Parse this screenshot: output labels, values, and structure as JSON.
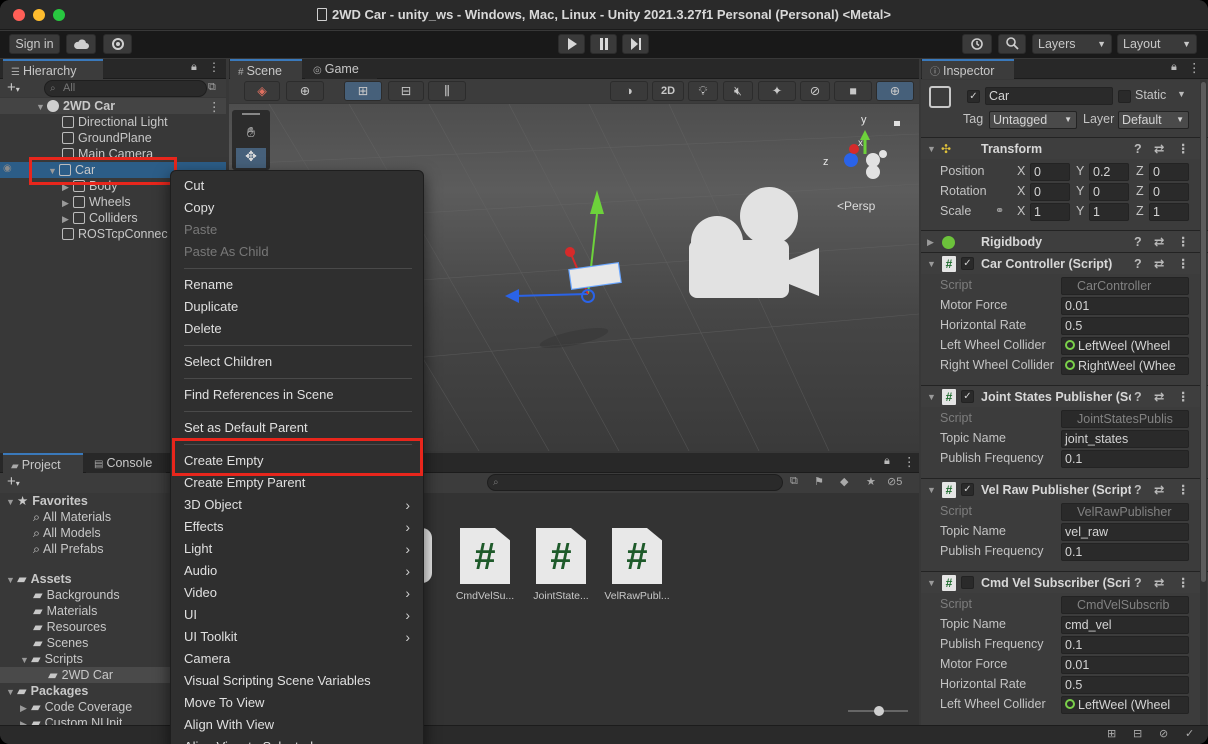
{
  "window": {
    "title": "2WD Car - unity_ws - Windows, Mac, Linux - Unity 2021.3.27f1 Personal (Personal) <Metal>"
  },
  "toolbar": {
    "sign_in": "Sign in",
    "layers": "Layers",
    "layout": "Layout"
  },
  "hierarchy": {
    "tab": "Hierarchy",
    "search_placeholder": "All",
    "scene": "2WD Car",
    "items": [
      "Directional Light",
      "GroundPlane",
      "Main Camera",
      "Car",
      "Body",
      "Wheels",
      "Colliders",
      "ROSTcpConnec"
    ]
  },
  "scene_view": {
    "tab_scene": "Scene",
    "tab_game": "Game",
    "mode_2d": "2D",
    "persp": "<Persp",
    "gizmo": {
      "x": "x",
      "y": "y",
      "z": "z"
    }
  },
  "context_menu": {
    "items": [
      {
        "label": "Cut",
        "disabled": false
      },
      {
        "label": "Copy",
        "disabled": false
      },
      {
        "label": "Paste",
        "disabled": true
      },
      {
        "label": "Paste As Child",
        "disabled": true
      },
      {
        "label": "Rename",
        "disabled": false
      },
      {
        "label": "Duplicate",
        "disabled": false
      },
      {
        "label": "Delete",
        "disabled": false
      },
      {
        "label": "Select Children",
        "disabled": false
      },
      {
        "label": "Find References in Scene",
        "disabled": false
      },
      {
        "label": "Set as Default Parent",
        "disabled": false
      },
      {
        "label": "Create Empty",
        "disabled": false,
        "highlighted": true
      },
      {
        "label": "Create Empty Parent",
        "disabled": false
      },
      {
        "label": "3D Object",
        "submenu": true
      },
      {
        "label": "Effects",
        "submenu": true
      },
      {
        "label": "Light",
        "submenu": true
      },
      {
        "label": "Audio",
        "submenu": true
      },
      {
        "label": "Video",
        "submenu": true
      },
      {
        "label": "UI",
        "submenu": true
      },
      {
        "label": "UI Toolkit",
        "submenu": true
      },
      {
        "label": "Camera",
        "disabled": false
      },
      {
        "label": "Visual Scripting Scene Variables",
        "disabled": false
      },
      {
        "label": "Move To View",
        "disabled": false
      },
      {
        "label": "Align With View",
        "disabled": false
      },
      {
        "label": "Align View to Selected",
        "disabled": false
      }
    ]
  },
  "project": {
    "tab_project": "Project",
    "tab_console": "Console",
    "favorites": "Favorites",
    "favorites_items": [
      "All Materials",
      "All Models",
      "All Prefabs"
    ],
    "assets": "Assets",
    "assets_items": [
      "Backgrounds",
      "Materials",
      "Resources",
      "Scenes",
      "Scripts"
    ],
    "scripts_child": "2WD Car",
    "packages": "Packages",
    "packages_items": [
      "Code Coverage",
      "Custom NUnit"
    ],
    "hidden_count": "5",
    "files": [
      "CmdVelSu...",
      "JointState...",
      "VelRawPubl..."
    ]
  },
  "inspector": {
    "tab": "Inspector",
    "object_name": "Car",
    "static_label": "Static",
    "tag_label": "Tag",
    "tag_value": "Untagged",
    "layer_label": "Layer",
    "layer_value": "Default",
    "transform": {
      "title": "Transform",
      "position_label": "Position",
      "position": [
        "0",
        "0.2",
        "0"
      ],
      "rotation_label": "Rotation",
      "rotation": [
        "0",
        "0",
        "0"
      ],
      "scale_label": "Scale",
      "scale": [
        "1",
        "1",
        "1"
      ],
      "axes": [
        "X",
        "Y",
        "Z"
      ]
    },
    "rigidbody": {
      "title": "Rigidbody"
    },
    "car_controller": {
      "title": "Car Controller (Script)",
      "rows": [
        {
          "label": "Script",
          "value": "CarController",
          "dim": true
        },
        {
          "label": "Motor Force",
          "value": "0.01"
        },
        {
          "label": "Horizontal Rate",
          "value": "0.5"
        },
        {
          "label": "Left Wheel Collider",
          "value": "LeftWeel (Wheel"
        },
        {
          "label": "Right Wheel Collider",
          "value": "RightWeel (Whee"
        }
      ]
    },
    "joint_states": {
      "title": "Joint States Publisher (Sc",
      "rows": [
        {
          "label": "Script",
          "value": "JointStatesPublis",
          "dim": true
        },
        {
          "label": "Topic Name",
          "value": "joint_states"
        },
        {
          "label": "Publish Frequency",
          "value": "0.1"
        }
      ]
    },
    "vel_raw": {
      "title": "Vel Raw Publisher (Script",
      "rows": [
        {
          "label": "Script",
          "value": "VelRawPublisher",
          "dim": true
        },
        {
          "label": "Topic Name",
          "value": "vel_raw"
        },
        {
          "label": "Publish Frequency",
          "value": "0.1"
        }
      ]
    },
    "cmd_vel": {
      "title": "Cmd Vel Subscriber (Scri",
      "rows": [
        {
          "label": "Script",
          "value": "CmdVelSubscrib",
          "dim": true
        },
        {
          "label": "Topic Name",
          "value": "cmd_vel"
        },
        {
          "label": "Publish Frequency",
          "value": "0.1"
        },
        {
          "label": "Motor Force",
          "value": "0.01"
        },
        {
          "label": "Horizontal Rate",
          "value": "0.5"
        },
        {
          "label": "Left Wheel Collider",
          "value": "LeftWeel (Wheel"
        }
      ]
    }
  },
  "colors": {
    "highlight_red": "#e8261c",
    "accent_blue": "#3a79bb",
    "script_green": "#1d6b2d"
  }
}
